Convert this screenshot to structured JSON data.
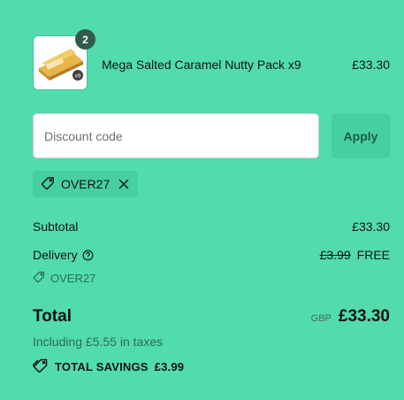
{
  "cart": {
    "item": {
      "quantity": "2",
      "name": "Mega Salted Caramel Nutty Pack x9",
      "price": "£33.30",
      "thumb_badge": "x9"
    }
  },
  "discount": {
    "placeholder": "Discount code",
    "apply_label": "Apply",
    "applied_code": "OVER27"
  },
  "summary": {
    "subtotal_label": "Subtotal",
    "subtotal_value": "£33.30",
    "delivery_label": "Delivery",
    "delivery_original": "£3.99",
    "delivery_value": "FREE",
    "delivery_code": "OVER27",
    "total_label": "Total",
    "currency": "GBP",
    "total_value": "£33.30",
    "taxes_text": "Including £5.55 in taxes",
    "savings_label": "TOTAL SAVINGS",
    "savings_value": "£3.99"
  },
  "colors": {
    "background": "#52dbaf",
    "badge": "#2f5c4b",
    "apply_button": "#47cfa4"
  },
  "icons": [
    "tag-icon",
    "close-icon",
    "help-circle-icon",
    "savings-tag-icon"
  ]
}
